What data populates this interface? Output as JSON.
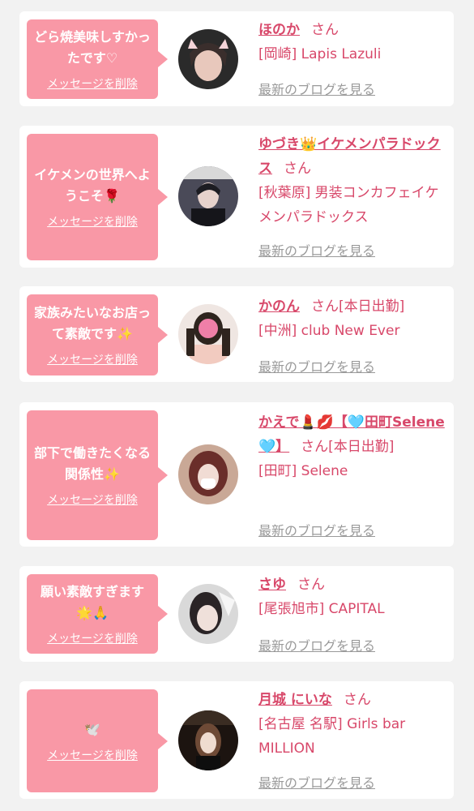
{
  "messages": [
    {
      "bubble_text": "どら焼美味しすかったです♡",
      "delete_label": "メッセージを削除",
      "name": "ほのか",
      "honorific": "さん",
      "status": "",
      "area": "[岡崎] Lapis Lazuli",
      "blog_label": "最新のブログを見る"
    },
    {
      "bubble_text": "イケメンの世界へようこそ🌹",
      "delete_label": "メッセージを削除",
      "name": "ゆづき👑イケメンパラドックス",
      "honorific": "さん",
      "status": "",
      "area": "[秋葉原] 男装コンカフェイケメンパラドックス",
      "blog_label": "最新のブログを見る"
    },
    {
      "bubble_text": "家族みたいなお店って素敵です✨",
      "delete_label": "メッセージを削除",
      "name": "かのん",
      "honorific": "さん",
      "status": "[本日出勤]",
      "area": "[中洲] club New Ever",
      "blog_label": "最新のブログを見る"
    },
    {
      "bubble_text": "部下で働きたくなる関係性✨",
      "delete_label": "メッセージを削除",
      "name": "かえで💄💋【🩵田町Selene🩵】",
      "honorific": "さん",
      "status": "[本日出勤]",
      "area": "[田町] Selene",
      "blog_label": "最新のブログを見る"
    },
    {
      "bubble_text": "願い素敵すぎます🌟🙏",
      "delete_label": "メッセージを削除",
      "name": "さゆ",
      "honorific": "さん",
      "status": "",
      "area": "[尾張旭市] CAPITAL",
      "blog_label": "最新のブログを見る"
    },
    {
      "bubble_text": "🕊️",
      "delete_label": "メッセージを削除",
      "name": "月城 にいな",
      "honorific": "さん",
      "status": "",
      "area": "[名古屋 名駅] Girls bar MILLION",
      "blog_label": "最新のブログを見る"
    }
  ],
  "avatar_icons": [
    "avatar-photo-honoka",
    "avatar-photo-yuzuki",
    "avatar-photo-kanon",
    "avatar-photo-kaede",
    "avatar-photo-sayu",
    "avatar-photo-niina"
  ],
  "colors": {
    "accent_pink": "#d8486a",
    "bubble_pink": "#f998a6",
    "card_bg": "#ffffff",
    "page_bg": "#f2f2f2",
    "link_gray": "#9a9a9a"
  }
}
